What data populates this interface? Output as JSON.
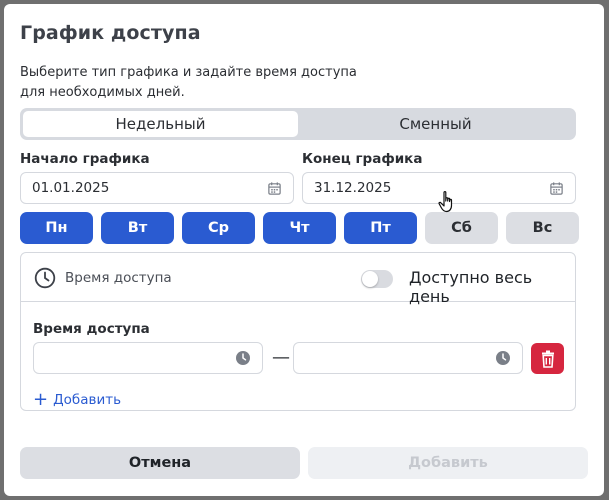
{
  "dialog": {
    "title": "График доступа",
    "description_line1": "Выберите тип графика и задайте время доступа",
    "description_line2": "для необходимых дней."
  },
  "schedule_type": {
    "options": [
      "Недельный",
      "Сменный"
    ],
    "selected": "Недельный"
  },
  "start": {
    "label": "Начало графика",
    "value": "01.01.2025",
    "icon": "calendar-icon"
  },
  "end": {
    "label": "Конец графика",
    "value": "31.12.2025",
    "icon": "calendar-icon"
  },
  "days": [
    {
      "label": "Пн",
      "active": true
    },
    {
      "label": "Вт",
      "active": true
    },
    {
      "label": "Ср",
      "active": true
    },
    {
      "label": "Чт",
      "active": true
    },
    {
      "label": "Пт",
      "active": true
    },
    {
      "label": "Сб",
      "active": false
    },
    {
      "label": "Вс",
      "active": false
    }
  ],
  "access": {
    "header_label": "Время доступа",
    "all_day_label": "Доступно весь день",
    "all_day_enabled": false,
    "time_title": "Время доступа",
    "from_value": "",
    "to_value": "",
    "separator": "—",
    "add_label": "Добавить"
  },
  "footer": {
    "cancel_label": "Отмена",
    "submit_label": "Добавить"
  },
  "colors": {
    "accent": "#2a5bd1",
    "danger": "#d6263f",
    "inactive": "#dcdee3"
  }
}
